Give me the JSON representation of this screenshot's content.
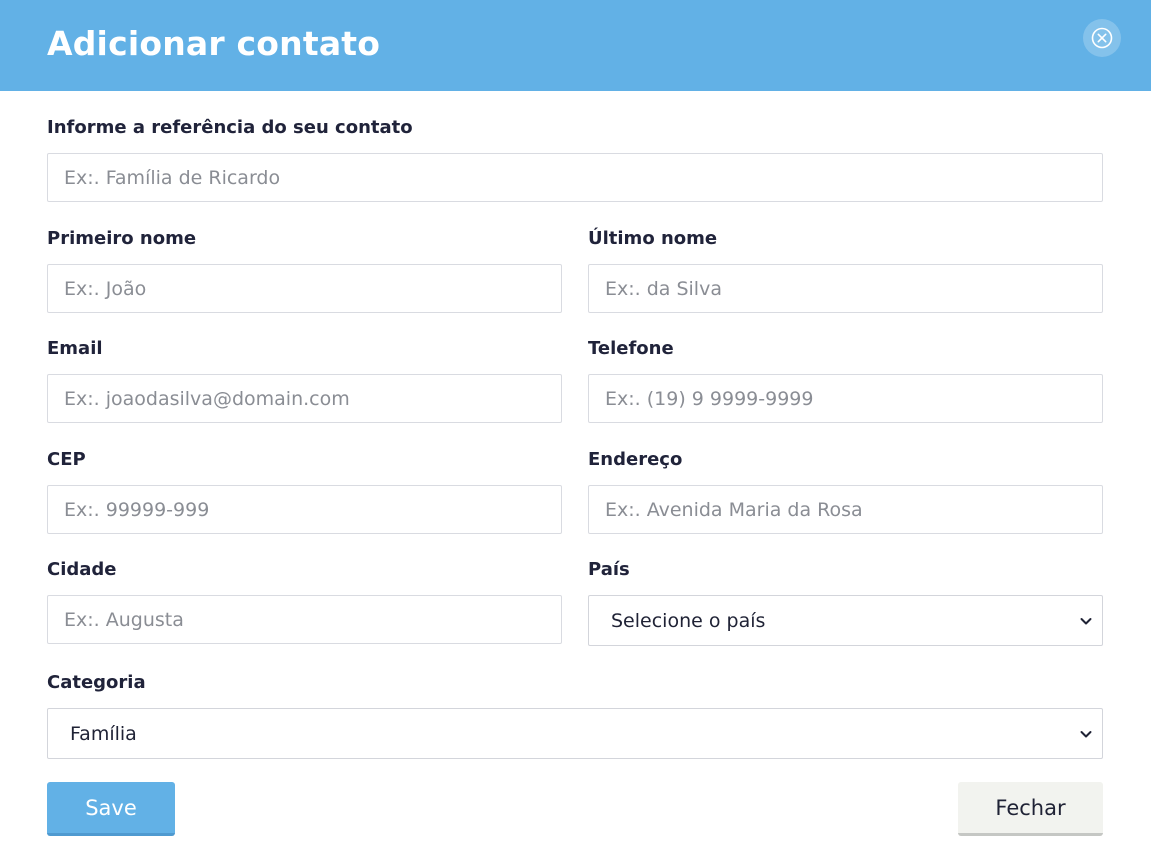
{
  "modal": {
    "title": "Adicionar contato",
    "close_icon": "close-circle-icon"
  },
  "form": {
    "reference": {
      "label": "Informe a referência do seu contato",
      "placeholder": "Ex:. Família de Ricardo",
      "value": ""
    },
    "first_name": {
      "label": "Primeiro nome",
      "placeholder": "Ex:. João",
      "value": ""
    },
    "last_name": {
      "label": "Último nome",
      "placeholder": "Ex:. da Silva",
      "value": ""
    },
    "email": {
      "label": "Email",
      "placeholder": "Ex:. joaodasilva@domain.com",
      "value": ""
    },
    "phone": {
      "label": "Telefone",
      "placeholder": "Ex:. (19) 9 9999-9999",
      "value": ""
    },
    "cep": {
      "label": "CEP",
      "placeholder": "Ex:. 99999-999",
      "value": ""
    },
    "address": {
      "label": "Endereço",
      "placeholder": "Ex:. Avenida Maria da Rosa",
      "value": ""
    },
    "city": {
      "label": "Cidade",
      "placeholder": "Ex:. Augusta",
      "value": ""
    },
    "country": {
      "label": "País",
      "selected": "Selecione o país"
    },
    "category": {
      "label": "Categoria",
      "selected": "Família"
    }
  },
  "buttons": {
    "save_label": "Save",
    "close_label": "Fechar"
  },
  "colors": {
    "accent": "#62b1e6",
    "secondary_button": "#f2f3ef",
    "input_border": "#d9dbe1"
  }
}
